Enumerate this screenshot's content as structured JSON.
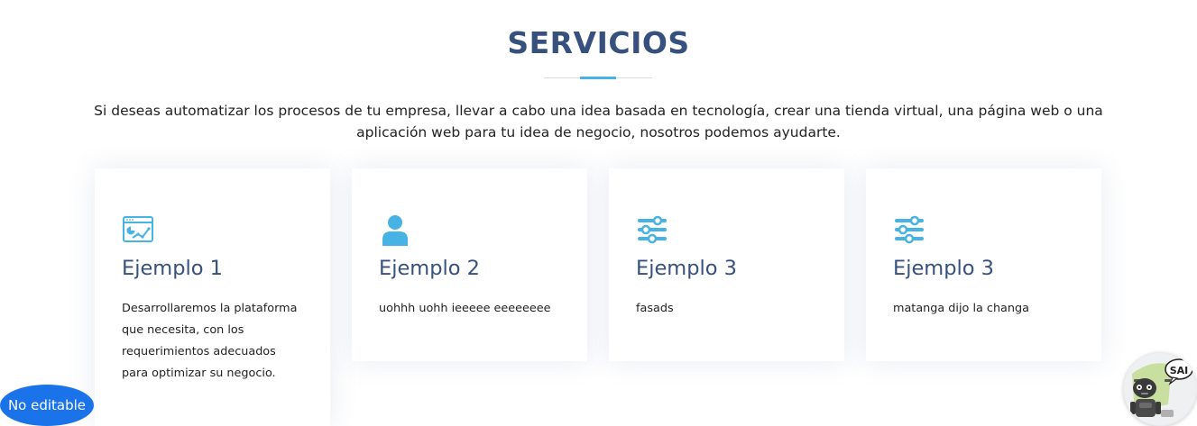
{
  "section": {
    "title": "SERVICIOS",
    "intro": "Si deseas automatizar los procesos de tu empresa, llevar a cabo una idea basada en tecnología, crear una tienda virtual, una página web o una aplicación web para tu idea de negocio, nosotros podemos ayudarte."
  },
  "cards": [
    {
      "title": "Ejemplo 1",
      "description": "Desarrollaremos la plataforma que necesita, con los requerimientos adecuados para optimizar su negocio.",
      "icon": "analytics-window-icon"
    },
    {
      "title": "Ejemplo 2",
      "description": "uohhh uohh ieeeee eeeeeeee",
      "icon": "user-icon"
    },
    {
      "title": "Ejemplo 3",
      "description": "fasads",
      "icon": "sliders-icon"
    },
    {
      "title": "Ejemplo 3",
      "description": "matanga dijo la changa",
      "icon": "sliders-icon"
    }
  ],
  "badge": {
    "label": "No editable"
  },
  "assistant": {
    "label": "SAI",
    "icon": "robot-assistant-icon"
  },
  "colors": {
    "heading": "#37517e",
    "accent": "#47b2e4",
    "badge": "#1a73e8"
  }
}
